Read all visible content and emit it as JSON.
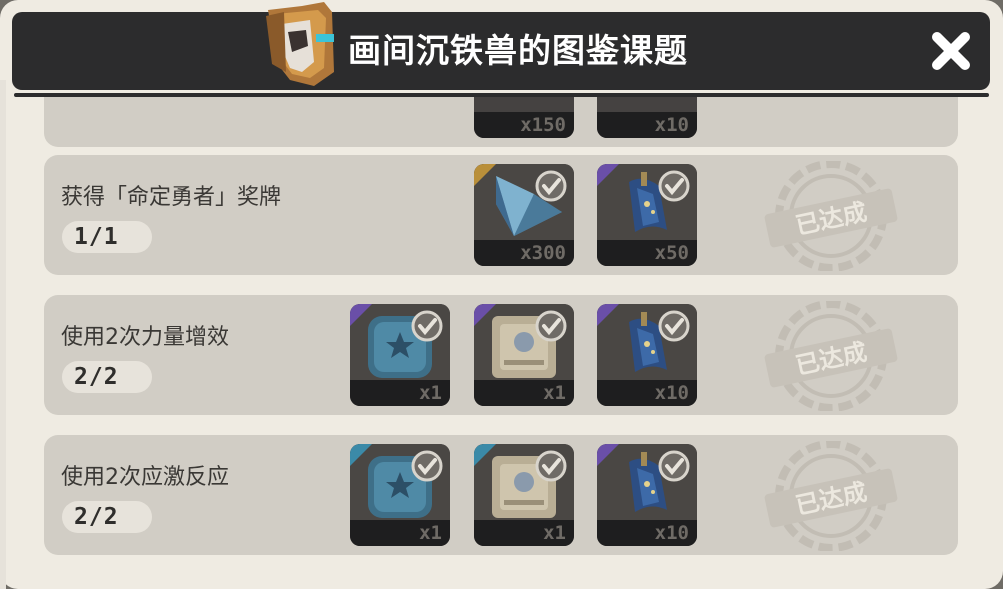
{
  "header": {
    "title": "画间沉铁兽的图鉴课题",
    "mask_icon": "mask-icon",
    "close_icon": "close-icon"
  },
  "stamp_text": "已达成",
  "partial_row": {
    "rewards": [
      {
        "qty": "x150"
      },
      {
        "qty": "x10"
      }
    ]
  },
  "tasks": [
    {
      "label": "获得「命定勇者」奖牌",
      "progress": "1/1",
      "rewards": [
        {
          "icon": "primogem-crystal-icon",
          "qty": "x300",
          "claimed": true,
          "rarity_color": "#b98f3a"
        },
        {
          "icon": "hero-wit-book-icon",
          "qty": "x50",
          "claimed": true,
          "rarity_color": "#6a4fa8"
        }
      ]
    },
    {
      "label": "使用2次力量增效",
      "progress": "2/2",
      "rewards": [
        {
          "icon": "blue-star-card-icon",
          "qty": "x1",
          "claimed": true,
          "rarity_color": "#6a4fa8"
        },
        {
          "icon": "scroll-card-icon",
          "qty": "x1",
          "claimed": true,
          "rarity_color": "#6a4fa8"
        },
        {
          "icon": "hero-wit-book-icon",
          "qty": "x10",
          "claimed": true,
          "rarity_color": "#6a4fa8"
        }
      ]
    },
    {
      "label": "使用2次应激反应",
      "progress": "2/2",
      "rewards": [
        {
          "icon": "blue-star-card-icon",
          "qty": "x1",
          "claimed": true,
          "rarity_color": "#3b8aa8"
        },
        {
          "icon": "scroll-card-icon",
          "qty": "x1",
          "claimed": true,
          "rarity_color": "#3b8aa8"
        },
        {
          "icon": "hero-wit-book-icon",
          "qty": "x10",
          "claimed": true,
          "rarity_color": "#6a4fa8"
        }
      ]
    }
  ],
  "colors": {
    "header_bg": "#2c2c2d",
    "panel_bg": "#efebe2",
    "row_bg": "#d1cdc5"
  }
}
